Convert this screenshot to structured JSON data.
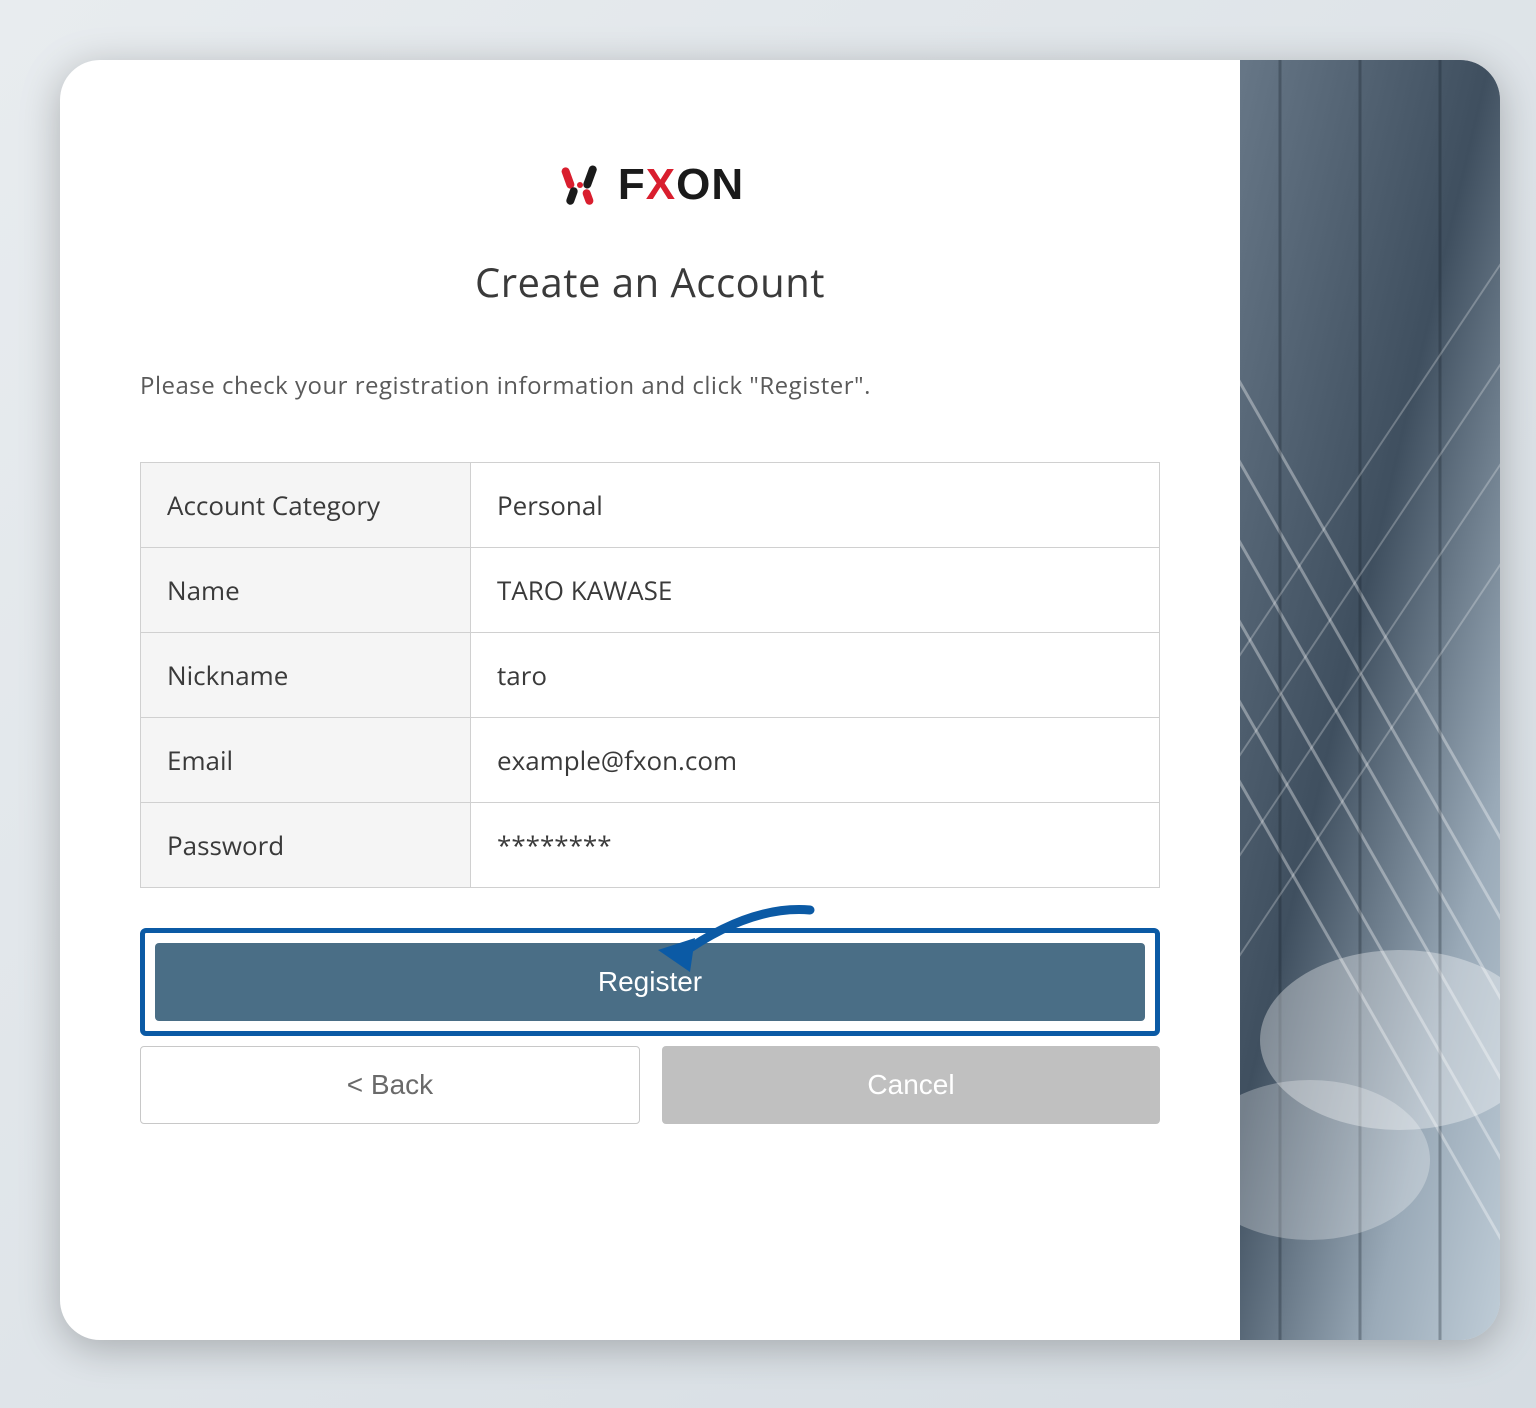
{
  "brand": {
    "name": "FXON"
  },
  "page": {
    "title": "Create an Account",
    "instruction": "Please check your registration information and click \"Register\"."
  },
  "fields": {
    "account_category": {
      "label": "Account Category",
      "value": "Personal"
    },
    "name": {
      "label": "Name",
      "value": "TARO KAWASE"
    },
    "nickname": {
      "label": "Nickname",
      "value": "taro"
    },
    "email": {
      "label": "Email",
      "value": "example@fxon.com"
    },
    "password": {
      "label": "Password",
      "value": "********"
    }
  },
  "buttons": {
    "register": "Register",
    "back": "< Back",
    "cancel": "Cancel"
  },
  "colors": {
    "accent_red": "#d91e2e",
    "highlight_blue": "#0b5aa5",
    "primary_button": "#4a6e86",
    "cancel_button": "#c0c0c0"
  }
}
